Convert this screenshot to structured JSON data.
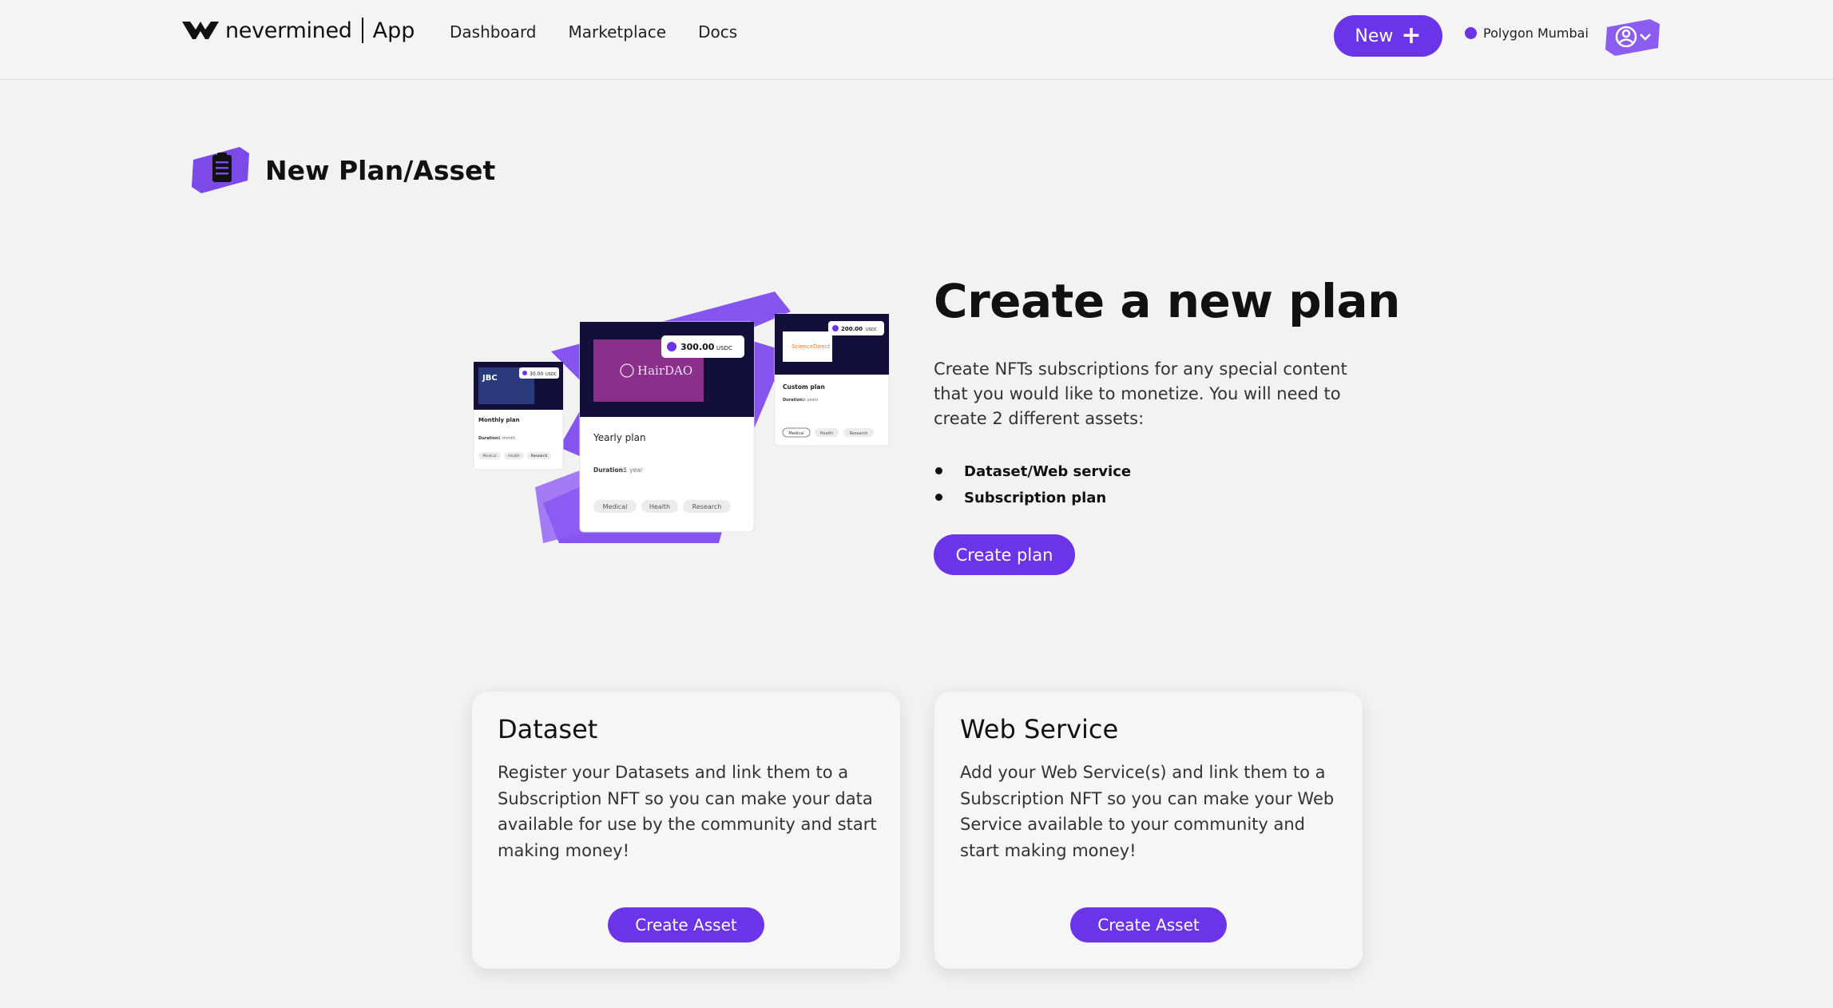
{
  "header": {
    "logo_word": "nevermined",
    "logo_app": "App",
    "nav": [
      "Dashboard",
      "Marketplace",
      "Docs"
    ],
    "new_button": "New",
    "network": "Polygon Mumbai"
  },
  "page": {
    "title": "New Plan/Asset"
  },
  "hero": {
    "title": "Create a new plan",
    "description": "Create NFTs subscriptions for any special content that you would like to monetize. You will need to create 2 different assets:",
    "list": [
      "Dataset/Web service",
      "Subscription plan"
    ],
    "button": "Create plan",
    "illustration": {
      "main_card": {
        "brand": "HairDAO",
        "price": "300.00",
        "currency": "USDC",
        "title": "Yearly plan",
        "duration_label": "Duration:",
        "duration_value": "1 year",
        "tags": [
          "Medical",
          "Health",
          "Research"
        ]
      },
      "left_card": {
        "price": "30.00",
        "currency": "USDC",
        "title": "Monthly plan",
        "duration_label": "Duration:",
        "duration_value": "1 month",
        "tags": [
          "Medical",
          "Health",
          "Research"
        ]
      },
      "right_card": {
        "brand": "ScienceDirect",
        "price": "200.00",
        "currency": "USDC",
        "title": "Custom plan",
        "duration_label": "Duration:",
        "duration_value": "x years",
        "tags": [
          "Medical",
          "Health",
          "Research"
        ]
      }
    }
  },
  "cards": [
    {
      "title": "Dataset",
      "description": "Register your Datasets and link them to a Subscription NFT so you can make your data available for use by the community and start making money!",
      "button": "Create Asset"
    },
    {
      "title": "Web Service",
      "description": "Add your Web Service(s) and link them to a Subscription NFT so you can make your Web Service available to your community and start making money!",
      "button": "Create Asset"
    }
  ],
  "colors": {
    "accent": "#6b34e8",
    "background": "#f2f2f2",
    "dark": "#12103a"
  }
}
